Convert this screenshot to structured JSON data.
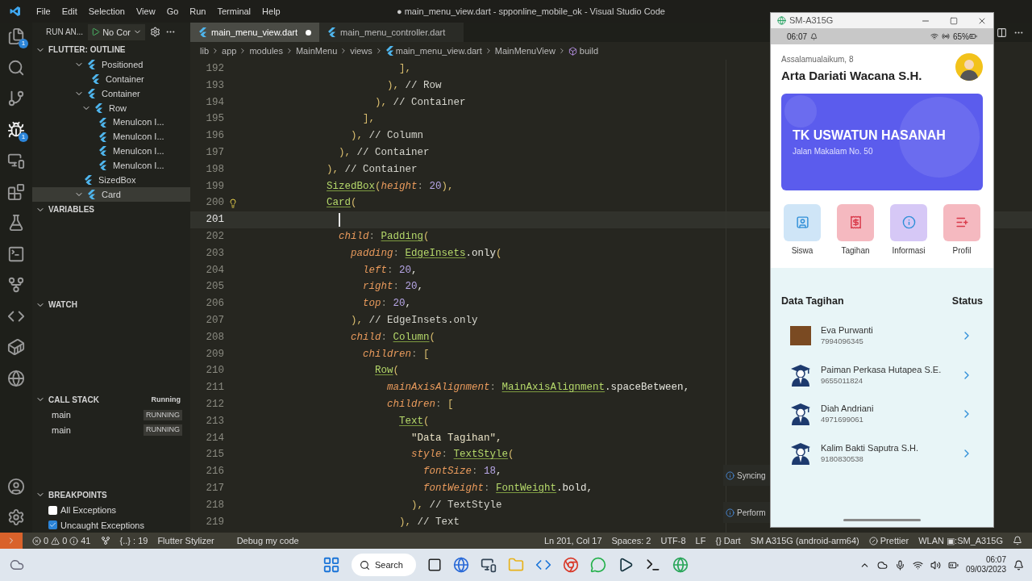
{
  "window": {
    "title": "● main_menu_view.dart - spponline_mobile_ok - Visual Studio Code"
  },
  "menu": [
    "File",
    "Edit",
    "Selection",
    "View",
    "Go",
    "Run",
    "Terminal",
    "Help"
  ],
  "activity_bar": {
    "explorer_badge": "1",
    "debug_badge": "1"
  },
  "debug_toolbar": {
    "label": "RUN AN...",
    "config": "No Cor"
  },
  "tabs": [
    {
      "label": "main_menu_view.dart",
      "selected": true,
      "modified": true
    },
    {
      "label": "main_menu_controller.dart",
      "selected": false,
      "modified": false
    }
  ],
  "breadcrumb": [
    "lib",
    "app",
    "modules",
    "MainMenu",
    "views",
    "main_menu_view.dart",
    "MainMenuView",
    "build"
  ],
  "outline": {
    "title": "FLUTTER: OUTLINE",
    "items": [
      {
        "label": "Positioned",
        "expanded": true,
        "selected": false,
        "children": [
          {
            "label": "Container",
            "selected": false
          }
        ]
      },
      {
        "label": "Container",
        "expanded": true,
        "selected": false,
        "children": [
          {
            "label": "Row",
            "expanded": true,
            "selected": false,
            "children": [
              {
                "label": "MenuIcon I...",
                "selected": false
              },
              {
                "label": "MenuIcon I...",
                "selected": false
              },
              {
                "label": "MenuIcon I...",
                "selected": false
              },
              {
                "label": "MenuIcon I...",
                "selected": false
              }
            ]
          }
        ]
      },
      {
        "label": "SizedBox",
        "selected": false
      },
      {
        "label": "Card",
        "expanded": true,
        "selected": true
      }
    ]
  },
  "variables": {
    "title": "VARIABLES"
  },
  "watch": {
    "title": "WATCH"
  },
  "call_stack": {
    "title": "CALL STACK",
    "status": "Running",
    "frames": [
      {
        "name": "main",
        "state": "RUNNING"
      },
      {
        "name": "main",
        "state": "RUNNING"
      }
    ]
  },
  "breakpoints": {
    "title": "BREAKPOINTS",
    "items": [
      {
        "label": "All Exceptions",
        "checked": false
      },
      {
        "label": "Uncaught Exceptions",
        "checked": true
      }
    ]
  },
  "code": [
    {
      "n": "192",
      "current": false,
      "lightbulb": false,
      "tokens": [
        {
          "text": "                          ],",
          "kind": "punct"
        }
      ]
    },
    {
      "n": "193",
      "current": false,
      "lightbulb": false,
      "tokens": [
        {
          "text": "                        ),",
          "kind": "punct"
        },
        {
          "text": " // Row",
          "kind": "comment"
        }
      ]
    },
    {
      "n": "194",
      "current": false,
      "lightbulb": false,
      "tokens": [
        {
          "text": "                      ),",
          "kind": "punct"
        },
        {
          "text": " // Container",
          "kind": "comment"
        }
      ]
    },
    {
      "n": "195",
      "current": false,
      "lightbulb": false,
      "tokens": [
        {
          "text": "                    ],",
          "kind": "punct"
        }
      ]
    },
    {
      "n": "196",
      "current": false,
      "lightbulb": false,
      "tokens": [
        {
          "text": "                  ),",
          "kind": "punct"
        },
        {
          "text": " // Column",
          "kind": "comment"
        }
      ]
    },
    {
      "n": "197",
      "current": false,
      "lightbulb": false,
      "tokens": [
        {
          "text": "                ),",
          "kind": "punct"
        },
        {
          "text": " // Container",
          "kind": "comment"
        }
      ]
    },
    {
      "n": "198",
      "current": false,
      "lightbulb": false,
      "tokens": [
        {
          "text": "              ),",
          "kind": "punct"
        },
        {
          "text": " // Container",
          "kind": "comment"
        }
      ]
    },
    {
      "n": "199",
      "current": false,
      "lightbulb": false,
      "tokens": [
        {
          "text": "              SizedBox",
          "kind": "type"
        },
        {
          "text": "(",
          "kind": "punct"
        },
        {
          "text": "height",
          "kind": "prop"
        },
        {
          "text": ": ",
          "kind": "colon"
        },
        {
          "text": "20",
          "kind": "num"
        },
        {
          "text": "),",
          "kind": "punct"
        }
      ]
    },
    {
      "n": "200",
      "current": false,
      "lightbulb": true,
      "tokens": [
        {
          "text": "              Card",
          "kind": "type"
        },
        {
          "text": "(",
          "kind": "punct"
        }
      ]
    },
    {
      "n": "201",
      "current": true,
      "lightbulb": false
    },
    {
      "n": "202",
      "current": false,
      "lightbulb": false,
      "tokens": [
        {
          "text": "                child",
          "kind": "prop"
        },
        {
          "text": ": ",
          "kind": "colon"
        },
        {
          "text": "Padding",
          "kind": "type"
        },
        {
          "text": "(",
          "kind": "punct"
        }
      ]
    },
    {
      "n": "203",
      "current": false,
      "lightbulb": false,
      "tokens": [
        {
          "text": "                  padding",
          "kind": "prop"
        },
        {
          "text": ": ",
          "kind": "colon"
        },
        {
          "text": "EdgeInsets",
          "kind": "type"
        },
        {
          "text": ".only",
          "kind": "plain"
        },
        {
          "text": "(",
          "kind": "punct"
        }
      ]
    },
    {
      "n": "204",
      "current": false,
      "lightbulb": false,
      "tokens": [
        {
          "text": "                    left",
          "kind": "prop"
        },
        {
          "text": ": ",
          "kind": "colon"
        },
        {
          "text": "20",
          "kind": "num"
        },
        {
          "text": ",",
          "kind": "plain"
        }
      ]
    },
    {
      "n": "205",
      "current": false,
      "lightbulb": false,
      "tokens": [
        {
          "text": "                    right",
          "kind": "prop"
        },
        {
          "text": ": ",
          "kind": "colon"
        },
        {
          "text": "20",
          "kind": "num"
        },
        {
          "text": ",",
          "kind": "plain"
        }
      ]
    },
    {
      "n": "206",
      "current": false,
      "lightbulb": false,
      "tokens": [
        {
          "text": "                    top",
          "kind": "prop"
        },
        {
          "text": ": ",
          "kind": "colon"
        },
        {
          "text": "20",
          "kind": "num"
        },
        {
          "text": ",",
          "kind": "plain"
        }
      ]
    },
    {
      "n": "207",
      "current": false,
      "lightbulb": false,
      "tokens": [
        {
          "text": "                  ),",
          "kind": "punct"
        },
        {
          "text": " // EdgeInsets.only",
          "kind": "comment"
        }
      ]
    },
    {
      "n": "208",
      "current": false,
      "lightbulb": false,
      "tokens": [
        {
          "text": "                  child",
          "kind": "prop"
        },
        {
          "text": ": ",
          "kind": "colon"
        },
        {
          "text": "Column",
          "kind": "type"
        },
        {
          "text": "(",
          "kind": "punct"
        }
      ]
    },
    {
      "n": "209",
      "current": false,
      "lightbulb": false,
      "tokens": [
        {
          "text": "                    children",
          "kind": "prop"
        },
        {
          "text": ": ",
          "kind": "colon"
        },
        {
          "text": "[",
          "kind": "punct"
        }
      ]
    },
    {
      "n": "210",
      "current": false,
      "lightbulb": false,
      "tokens": [
        {
          "text": "                      Row",
          "kind": "type"
        },
        {
          "text": "(",
          "kind": "punct"
        }
      ]
    },
    {
      "n": "211",
      "current": false,
      "lightbulb": false,
      "tokens": [
        {
          "text": "                        mainAxisAlignment",
          "kind": "prop"
        },
        {
          "text": ": ",
          "kind": "colon"
        },
        {
          "text": "MainAxisAlignment",
          "kind": "type"
        },
        {
          "text": ".spaceBetween,",
          "kind": "plain"
        }
      ]
    },
    {
      "n": "212",
      "current": false,
      "lightbulb": false,
      "tokens": [
        {
          "text": "                        children",
          "kind": "prop"
        },
        {
          "text": ": ",
          "kind": "colon"
        },
        {
          "text": "[",
          "kind": "punct"
        }
      ]
    },
    {
      "n": "213",
      "current": false,
      "lightbulb": false,
      "tokens": [
        {
          "text": "                          Text",
          "kind": "type"
        },
        {
          "text": "(",
          "kind": "punct"
        }
      ]
    },
    {
      "n": "214",
      "current": false,
      "lightbulb": false,
      "tokens": [
        {
          "text": "                            \"Data Tagihan\",",
          "kind": "str"
        }
      ]
    },
    {
      "n": "215",
      "current": false,
      "lightbulb": false,
      "tokens": [
        {
          "text": "                            style",
          "kind": "prop"
        },
        {
          "text": ": ",
          "kind": "colon"
        },
        {
          "text": "TextStyle",
          "kind": "type"
        },
        {
          "text": "(",
          "kind": "punct"
        }
      ]
    },
    {
      "n": "216",
      "current": false,
      "lightbulb": false,
      "tokens": [
        {
          "text": "                              fontSize",
          "kind": "prop"
        },
        {
          "text": ": ",
          "kind": "colon"
        },
        {
          "text": "18",
          "kind": "num"
        },
        {
          "text": ",",
          "kind": "plain"
        }
      ]
    },
    {
      "n": "217",
      "current": false,
      "lightbulb": false,
      "tokens": [
        {
          "text": "                              fontWeight",
          "kind": "prop"
        },
        {
          "text": ": ",
          "kind": "colon"
        },
        {
          "text": "FontWeight",
          "kind": "type"
        },
        {
          "text": ".bold,",
          "kind": "plain"
        }
      ]
    },
    {
      "n": "218",
      "current": false,
      "lightbulb": false,
      "tokens": [
        {
          "text": "                            ),",
          "kind": "punct"
        },
        {
          "text": " // TextStyle",
          "kind": "comment"
        }
      ]
    },
    {
      "n": "219",
      "current": false,
      "lightbulb": false,
      "tokens": [
        {
          "text": "                          ),",
          "kind": "punct"
        },
        {
          "text": " // Text",
          "kind": "comment"
        }
      ]
    }
  ],
  "notifications": [
    "Syncing",
    "Perform"
  ],
  "phone": {
    "window_title": "SM-A315G",
    "time": "06:07",
    "battery": "65%",
    "greeting": "Assalamualaikum, 8",
    "user_name": "Arta Dariati Wacana S.H.",
    "banner": {
      "title": "TK USWATUN HASANAH",
      "subtitle": "Jalan Makalam No. 50"
    },
    "menu": [
      {
        "label": "Siswa",
        "kind": "student",
        "color": "#cfe5f7"
      },
      {
        "label": "Tagihan",
        "kind": "bill",
        "color": "#f5b9c0"
      },
      {
        "label": "Informasi",
        "kind": "info",
        "color": "#d6c8f6"
      },
      {
        "label": "Profil",
        "kind": "profile",
        "color": "#f5b9c0"
      }
    ],
    "section_title": "Data Tagihan",
    "section_status": "Status",
    "students": [
      {
        "name": "Eva Purwanti",
        "number": "7994096345",
        "kind": "photo"
      },
      {
        "name": "Paiman Perkasa Hutapea S.E.",
        "number": "9655011824",
        "kind": "graduate"
      },
      {
        "name": "Diah Andriani",
        "number": "4971699061",
        "kind": "graduate"
      },
      {
        "name": "Kalim Bakti Saputra S.H.",
        "number": "9180830538",
        "kind": "graduate"
      }
    ]
  },
  "status_bar": {
    "errors": "0",
    "warnings": "0",
    "infos": "41",
    "braces": "{..} : 19",
    "left_items": [
      "Flutter Stylizer",
      "Debug my code"
    ],
    "position": "Ln 201, Col 17",
    "indent": "Spaces: 2",
    "encoding": "UTF-8",
    "eol": "LF",
    "language": "{} Dart",
    "device": "SM A315G (android-arm64)",
    "formatter": "Prettier",
    "network": "WLAN ▣:SM_A315G"
  },
  "taskbar": {
    "search": "Search",
    "time": "06:07",
    "date": "09/03/2023"
  }
}
